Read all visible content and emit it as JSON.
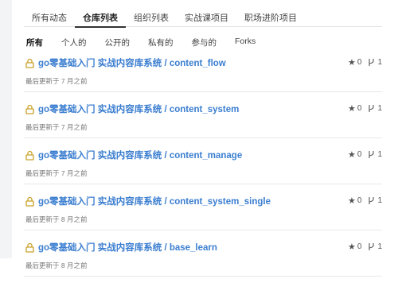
{
  "main_tabs": [
    {
      "label": "所有动态"
    },
    {
      "label": "仓库列表"
    },
    {
      "label": "组织列表"
    },
    {
      "label": "实战课项目"
    },
    {
      "label": "职场进阶项目"
    }
  ],
  "sub_tabs": [
    {
      "label": "所有"
    },
    {
      "label": "个人的"
    },
    {
      "label": "公开的"
    },
    {
      "label": "私有的"
    },
    {
      "label": "参与的"
    },
    {
      "label": "Forks"
    }
  ],
  "repos": [
    {
      "title": "go零基础入门 实战内容库系统 / content_flow",
      "updated": "最后更新于 7 月之前",
      "stars": "0",
      "forks": "1"
    },
    {
      "title": "go零基础入门 实战内容库系统 / content_system",
      "updated": "最后更新于 7 月之前",
      "stars": "0",
      "forks": "1"
    },
    {
      "title": "go零基础入门 实战内容库系统 / content_manage",
      "updated": "最后更新于 7 月之前",
      "stars": "0",
      "forks": "1"
    },
    {
      "title": "go零基础入门 实战内容库系统 / content_system_single",
      "updated": "最后更新于 8 月之前",
      "stars": "0",
      "forks": "1"
    },
    {
      "title": "go零基础入门 实战内容库系统 / base_learn",
      "updated": "最后更新于 8 月之前",
      "stars": "0",
      "forks": "1"
    }
  ],
  "colors": {
    "link": "#3b7ed0",
    "lock": "#c9a227"
  },
  "icons": {
    "lock": "lock-icon",
    "star": "star-icon",
    "fork": "fork-icon"
  }
}
